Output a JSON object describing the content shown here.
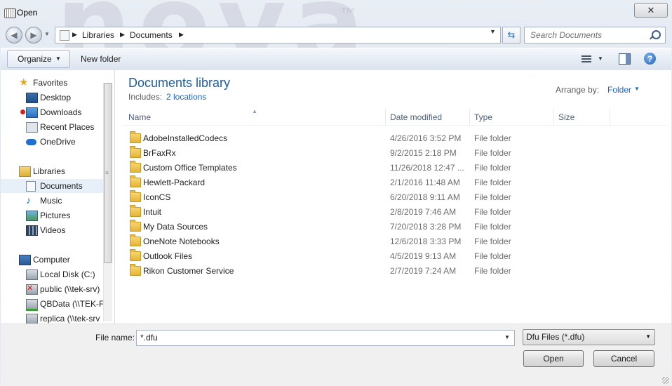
{
  "window": {
    "title": "Open",
    "close_glyph": "✕"
  },
  "nav": {
    "back_glyph": "◀",
    "forward_glyph": "▶",
    "breadcrumb": [
      "Libraries",
      "Documents"
    ],
    "search_placeholder": "Search Documents"
  },
  "toolbar": {
    "organize_label": "Organize",
    "new_folder_label": "New folder",
    "help_glyph": "?"
  },
  "sidebar": {
    "items": [
      {
        "label": "Favorites",
        "icon": "star-icon",
        "header": true
      },
      {
        "label": "Desktop",
        "icon": "desktop-icon"
      },
      {
        "label": "Downloads",
        "icon": "downloads-icon"
      },
      {
        "label": "Recent Places",
        "icon": "recent-places-icon"
      },
      {
        "label": "OneDrive",
        "icon": "cloud-icon"
      },
      {
        "label": "Libraries",
        "icon": "libraries-icon",
        "header": true
      },
      {
        "label": "Documents",
        "icon": "documents-icon",
        "selected": true
      },
      {
        "label": "Music",
        "icon": "music-icon"
      },
      {
        "label": "Pictures",
        "icon": "pictures-icon"
      },
      {
        "label": "Videos",
        "icon": "videos-icon"
      },
      {
        "label": "Computer",
        "icon": "computer-icon",
        "header": true
      },
      {
        "label": "Local Disk (C:)",
        "icon": "disk-icon"
      },
      {
        "label": "public (\\\\tek-srv)",
        "icon": "network-drive-disconnected-icon"
      },
      {
        "label": "QBData (\\\\TEK-F",
        "icon": "network-drive-icon"
      },
      {
        "label": "replica (\\\\tek-srv",
        "icon": "network-drive-icon"
      }
    ]
  },
  "content": {
    "library_title": "Documents library",
    "includes_label": "Includes:",
    "locations_link": "2 locations",
    "arrange_label": "Arrange by:",
    "arrange_value": "Folder",
    "columns": {
      "name": "Name",
      "date": "Date modified",
      "type": "Type",
      "size": "Size"
    },
    "files": [
      {
        "name": "AdobeInstalledCodecs",
        "date": "4/26/2016 3:52 PM",
        "type": "File folder"
      },
      {
        "name": "BrFaxRx",
        "date": "9/2/2015 2:18 PM",
        "type": "File folder"
      },
      {
        "name": "Custom Office Templates",
        "date": "11/26/2018 12:47 ...",
        "type": "File folder"
      },
      {
        "name": "Hewlett-Packard",
        "date": "2/1/2016 11:48 AM",
        "type": "File folder"
      },
      {
        "name": "IconCS",
        "date": "6/20/2018 9:11 AM",
        "type": "File folder"
      },
      {
        "name": "Intuit",
        "date": "2/8/2019 7:46 AM",
        "type": "File folder"
      },
      {
        "name": "My Data Sources",
        "date": "7/20/2018 3:28 PM",
        "type": "File folder"
      },
      {
        "name": "OneNote Notebooks",
        "date": "12/6/2018 3:33 PM",
        "type": "File folder"
      },
      {
        "name": "Outlook Files",
        "date": "4/5/2019 9:13 AM",
        "type": "File folder"
      },
      {
        "name": "Rikon Customer Service",
        "date": "2/7/2019 7:24 AM",
        "type": "File folder"
      }
    ]
  },
  "footer": {
    "file_name_label": "File name:",
    "file_name_value": "*.dfu",
    "filter_value": "Dfu Files (*.dfu)",
    "open_label": "Open",
    "cancel_label": "Cancel"
  },
  "background_watermark": {
    "text": "nova",
    "tm": "™"
  }
}
